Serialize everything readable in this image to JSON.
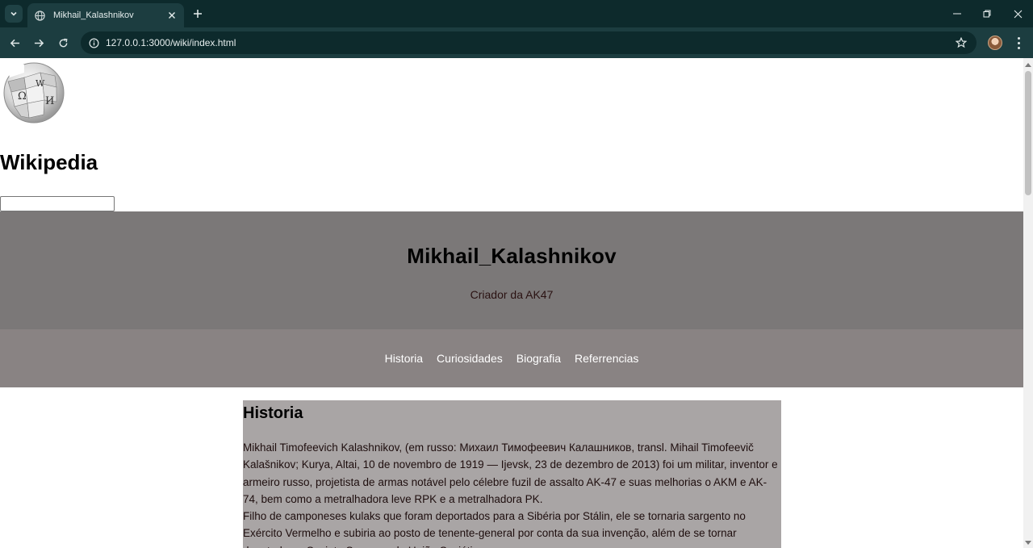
{
  "browser": {
    "tab_title": "Mikhail_Kalashnikov",
    "url": "127.0.0.1:3000/wiki/index.html"
  },
  "site": {
    "name": "Wikipedia",
    "search_placeholder": "",
    "logo_letters": [
      "Ω",
      "W",
      "И"
    ]
  },
  "hero": {
    "title": "Mikhail_Kalashnikov",
    "subtitle": "Criador da AK47"
  },
  "nav": {
    "items": [
      {
        "label": "Historia"
      },
      {
        "label": "Curiosidades"
      },
      {
        "label": "Biografia"
      },
      {
        "label": "Referrencias"
      }
    ]
  },
  "section": {
    "heading": "Historia",
    "paragraph_1": "Mikhail Timofeevich Kalashnikov, (em russo: Михаил Тимофеевич Калашников, transl. Mihail Timofeevič Kalašnikov; Kurya, Altai, 10 de novembro de 1919 — Ijevsk, 23 de dezembro de 2013) foi um militar, inventor e armeiro russo, projetista de armas notável pelo célebre fuzil de assalto AK-47 e suas melhorias o AKM e AK-74, bem como a metralhadora leve RPK e a metralhadora PK.",
    "paragraph_2": "Filho de camponeses kulaks que foram deportados para a Sibéria por Stálin, ele se tornaria sargento no Exército Vermelho e subiria ao posto de tenente-general por conta da sua invenção, além de se tornar deputado no Soviete Supremo da União Soviética."
  },
  "colors": {
    "hero_bg": "#7b7878",
    "nav_bg": "#898383",
    "content_bg": "#a9a5a5",
    "chrome_dark": "#0d2a2c",
    "chrome_light": "#1c3d40"
  }
}
